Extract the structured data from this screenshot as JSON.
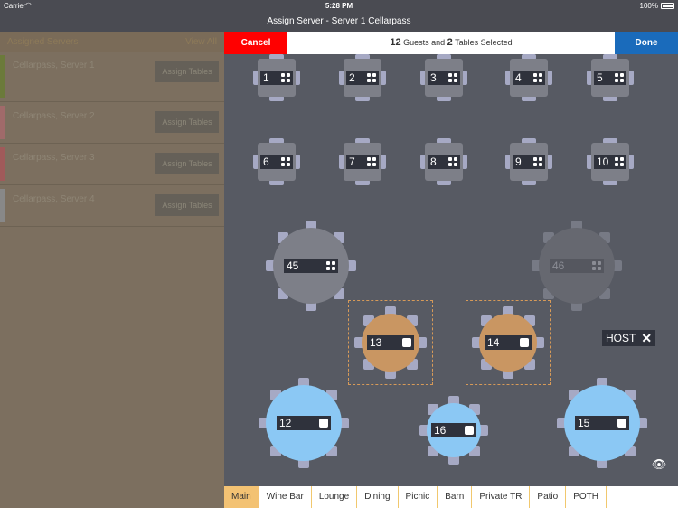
{
  "status_bar": {
    "carrier": "Carrier",
    "time": "5:28 PM",
    "battery": "100%"
  },
  "title": "Assign Server - Server 1 Cellarpass",
  "left_panel": {
    "header": "Assigned Servers",
    "view_all": "View All",
    "servers": [
      {
        "name": "Cellarpass, Server 1",
        "color": "#6b7a3a",
        "assign_label": "Assign Tables"
      },
      {
        "name": "Cellarpass, Server 2",
        "color": "#a06a6a",
        "assign_label": "Assign Tables"
      },
      {
        "name": "Cellarpass, Server 3",
        "color": "#a05a5a",
        "assign_label": "Assign Tables"
      },
      {
        "name": "Cellarpass, Server 4",
        "color": "#888888",
        "assign_label": "Assign Tables"
      }
    ]
  },
  "action_bar": {
    "cancel": "Cancel",
    "done": "Done",
    "guests_count": "12",
    "guests_text": "Guests and",
    "tables_count": "2",
    "tables_text": "Tables Selected"
  },
  "tables": [
    {
      "id": "1",
      "shape": "square",
      "state": "default"
    },
    {
      "id": "2",
      "shape": "square",
      "state": "default"
    },
    {
      "id": "3",
      "shape": "square",
      "state": "default"
    },
    {
      "id": "4",
      "shape": "square",
      "state": "default"
    },
    {
      "id": "5",
      "shape": "square",
      "state": "default"
    },
    {
      "id": "6",
      "shape": "square",
      "state": "default"
    },
    {
      "id": "7",
      "shape": "square",
      "state": "default"
    },
    {
      "id": "8",
      "shape": "square",
      "state": "default"
    },
    {
      "id": "9",
      "shape": "square",
      "state": "default"
    },
    {
      "id": "10",
      "shape": "square",
      "state": "default"
    },
    {
      "id": "45",
      "shape": "round-large",
      "state": "default"
    },
    {
      "id": "46",
      "shape": "round-large",
      "state": "disabled"
    },
    {
      "id": "13",
      "shape": "round-medium",
      "state": "selected"
    },
    {
      "id": "14",
      "shape": "round-medium",
      "state": "selected"
    },
    {
      "id": "12",
      "shape": "round-large",
      "state": "assigned"
    },
    {
      "id": "16",
      "shape": "round-small",
      "state": "assigned"
    },
    {
      "id": "15",
      "shape": "round-large",
      "state": "assigned"
    }
  ],
  "host": {
    "label": "HOST"
  },
  "colors": {
    "cancel": "#ff0000",
    "done": "#1a6bbb",
    "selected_table": "#c99662",
    "assigned_table": "#8bc8f4",
    "default_table": "#7d7f88",
    "active_tab": "#f3c273"
  },
  "tabs": [
    {
      "label": "Main",
      "active": true
    },
    {
      "label": "Wine Bar",
      "active": false
    },
    {
      "label": "Lounge",
      "active": false
    },
    {
      "label": "Dining",
      "active": false
    },
    {
      "label": "Picnic",
      "active": false
    },
    {
      "label": "Barn",
      "active": false
    },
    {
      "label": "Private TR",
      "active": false
    },
    {
      "label": "Patio",
      "active": false
    },
    {
      "label": "POTH",
      "active": false
    }
  ]
}
